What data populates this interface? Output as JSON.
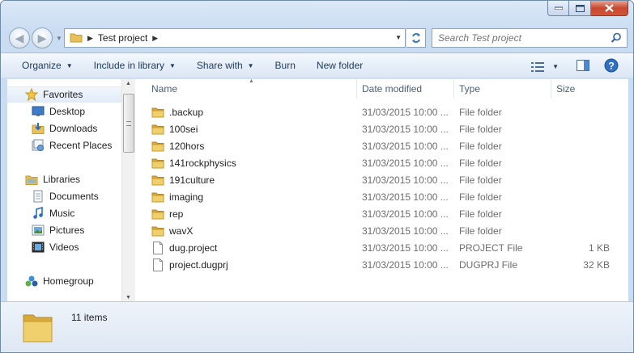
{
  "window": {
    "caption_buttons": [
      "minimize",
      "maximize",
      "close"
    ]
  },
  "address": {
    "path": [
      "Test project"
    ],
    "search_placeholder": "Search Test project"
  },
  "toolbar": {
    "organize": "Organize",
    "include_in_library": "Include in library",
    "share_with": "Share with",
    "burn": "Burn",
    "new_folder": "New folder"
  },
  "nav": {
    "favorites": "Favorites",
    "desktop": "Desktop",
    "downloads": "Downloads",
    "recent_places": "Recent Places",
    "libraries": "Libraries",
    "documents": "Documents",
    "music": "Music",
    "pictures": "Pictures",
    "videos": "Videos",
    "homegroup": "Homegroup"
  },
  "columns": {
    "name": "Name",
    "date_modified": "Date modified",
    "type": "Type",
    "size": "Size"
  },
  "files": [
    {
      "name": ".backup",
      "date": "31/03/2015 10:00 ...",
      "type": "File folder",
      "size": "",
      "kind": "folder"
    },
    {
      "name": "100sei",
      "date": "31/03/2015 10:00 ...",
      "type": "File folder",
      "size": "",
      "kind": "folder"
    },
    {
      "name": "120hors",
      "date": "31/03/2015 10:00 ...",
      "type": "File folder",
      "size": "",
      "kind": "folder"
    },
    {
      "name": "141rockphysics",
      "date": "31/03/2015 10:00 ...",
      "type": "File folder",
      "size": "",
      "kind": "folder"
    },
    {
      "name": "191culture",
      "date": "31/03/2015 10:00 ...",
      "type": "File folder",
      "size": "",
      "kind": "folder"
    },
    {
      "name": "imaging",
      "date": "31/03/2015 10:00 ...",
      "type": "File folder",
      "size": "",
      "kind": "folder"
    },
    {
      "name": "rep",
      "date": "31/03/2015 10:00 ...",
      "type": "File folder",
      "size": "",
      "kind": "folder"
    },
    {
      "name": "wavX",
      "date": "31/03/2015 10:00 ...",
      "type": "File folder",
      "size": "",
      "kind": "folder"
    },
    {
      "name": "dug.project",
      "date": "31/03/2015 10:00 ...",
      "type": "PROJECT File",
      "size": "1 KB",
      "kind": "file"
    },
    {
      "name": "project.dugprj",
      "date": "31/03/2015 10:00 ...",
      "type": "DUGPRJ File",
      "size": "32 KB",
      "kind": "file"
    }
  ],
  "status": {
    "item_count": "11 items"
  },
  "colors": {
    "folder": "#e8c15a",
    "toolbar_text": "#1e395b",
    "header_text": "#4c607a"
  }
}
